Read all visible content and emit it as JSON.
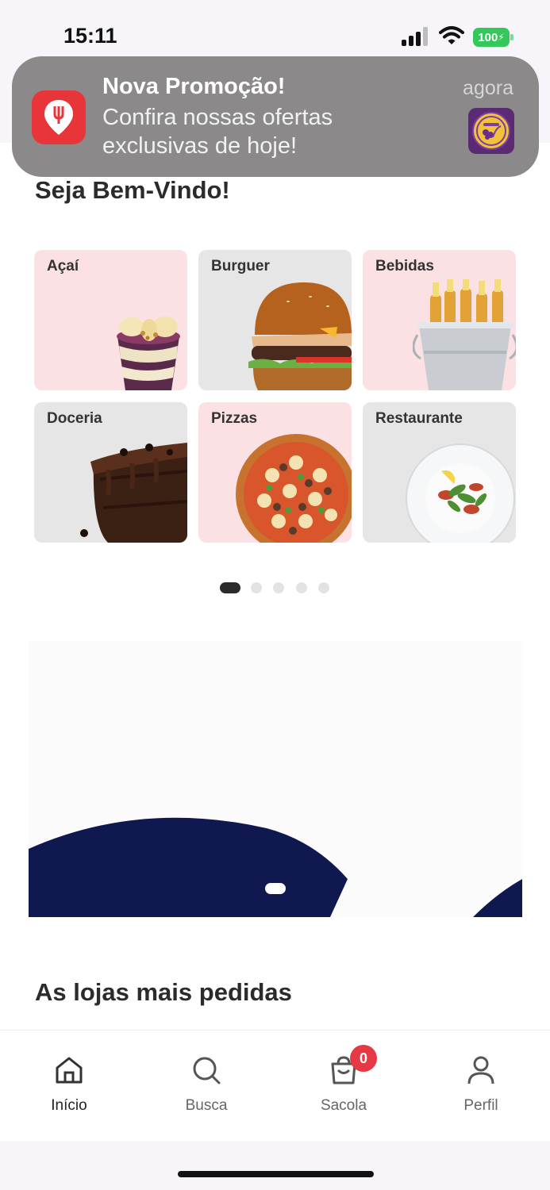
{
  "status_bar": {
    "time": "15:11",
    "battery": "100"
  },
  "notification": {
    "title": "Nova Promoção!",
    "body": "Confira nossas ofertas exclusivas de hoje!",
    "time": "agora",
    "app_icon": "location-pin-icon",
    "thumbnail_text": "Açaí da Lidi"
  },
  "greeting": "Seja Bem-Vindo!",
  "categories": [
    {
      "label": "Açaí",
      "icon": "acai-cup"
    },
    {
      "label": "Burguer",
      "icon": "burger"
    },
    {
      "label": "Bebidas",
      "icon": "beer-bucket"
    },
    {
      "label": "Doceria",
      "icon": "brownie"
    },
    {
      "label": "Pizzas",
      "icon": "pizza"
    },
    {
      "label": "Restaurante",
      "icon": "salad-plate"
    }
  ],
  "carousel": {
    "pages": 5,
    "active": 1
  },
  "section_title": "As lojas mais pedidas",
  "bottom_nav": [
    {
      "label": "Início",
      "icon": "home-icon",
      "active": true
    },
    {
      "label": "Busca",
      "icon": "search-icon",
      "active": false
    },
    {
      "label": "Sacola",
      "icon": "bag-icon",
      "active": false,
      "badge": "0"
    },
    {
      "label": "Perfil",
      "icon": "user-icon",
      "active": false
    }
  ],
  "colors": {
    "accent": "#e53945",
    "pink_card": "#fbe1e4",
    "gray_card": "#e6e6e6",
    "banner_navy": "#101850"
  }
}
